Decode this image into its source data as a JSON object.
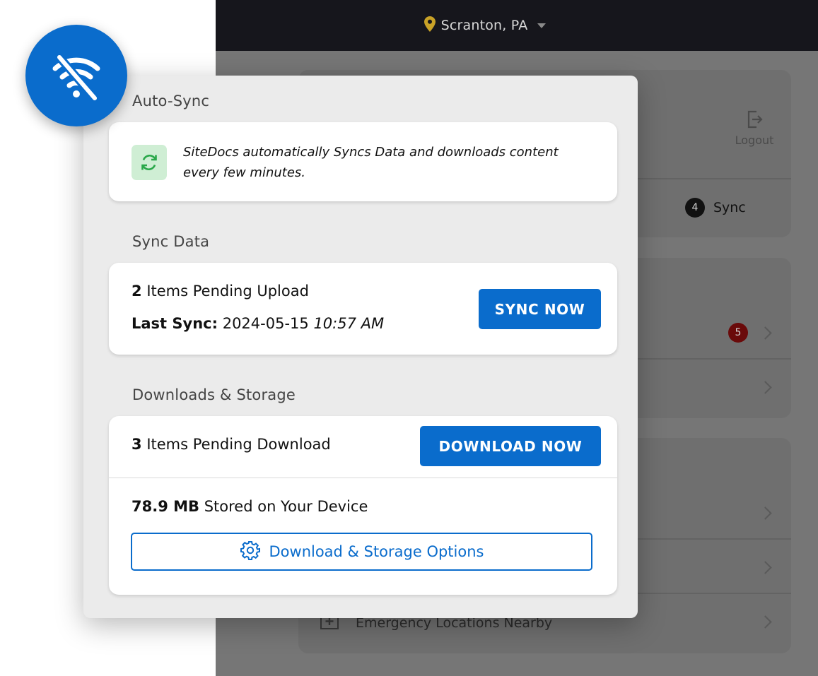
{
  "background_app": {
    "location": "Scranton, PA",
    "logout_label": "Logout",
    "sync_label": "Sync",
    "sync_count": "4",
    "notification_count": "5",
    "emergency_label": "Emergency Locations Nearby"
  },
  "panel": {
    "auto_sync": {
      "title": "Auto-Sync",
      "description": "SiteDocs automatically Syncs Data and downloads content every few minutes."
    },
    "sync_data": {
      "title": "Sync Data",
      "pending_count": "2",
      "pending_label": "Items Pending Upload",
      "last_sync_label": "Last Sync:",
      "last_sync_date": "2024-05-15",
      "last_sync_time": "10:57 AM",
      "button_label": "SYNC NOW"
    },
    "downloads": {
      "title": "Downloads & Storage",
      "pending_count": "3",
      "pending_label": "Items Pending Download",
      "button_label": "DOWNLOAD NOW",
      "storage_amount": "78.9 MB",
      "storage_label": "Stored on Your Device",
      "options_label": "Download & Storage Options"
    }
  },
  "colors": {
    "accent": "#0a6ccc",
    "sync_icon": "#2aa84a",
    "sync_icon_bg": "#cfeed4",
    "header": "#16161c"
  },
  "icons": {
    "offline": "wifi-off-icon",
    "location": "location-pin-icon",
    "auto_sync": "sync-icon",
    "options": "gear-icon",
    "logout": "logout-icon"
  }
}
